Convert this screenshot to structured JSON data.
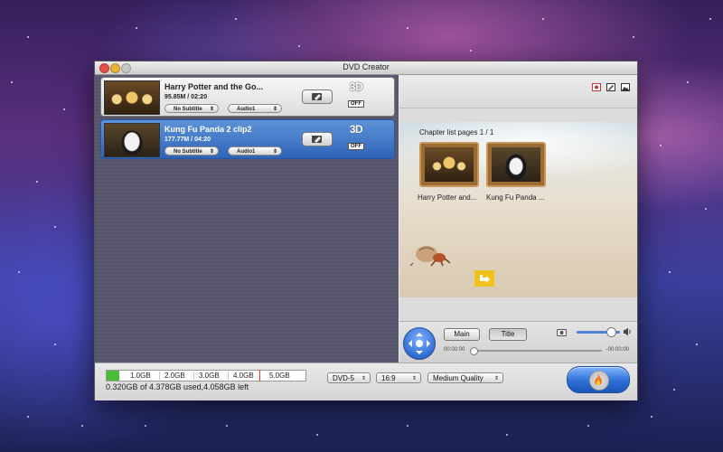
{
  "window": {
    "title": "DVD Creator"
  },
  "items": [
    {
      "name": "Harry Potter and the Go...",
      "meta": "95.85M / 02:20",
      "subtitle": "No Subtitle",
      "audio": "Audio1",
      "threed": "3D",
      "threed_state": "OFF",
      "selected": false
    },
    {
      "name": "Kung Fu Panda 2 clip2",
      "meta": "177.77M / 04:20",
      "subtitle": "No Subtitle",
      "audio": "Audio1",
      "threed": "3D",
      "threed_state": "OFF",
      "selected": true
    }
  ],
  "preview": {
    "chapter_header": "Chapter list pages 1 / 1",
    "chapters": [
      "Harry Potter and...",
      "Kung Fu Panda ..."
    ]
  },
  "controls": {
    "main_label": "Main",
    "title_label": "Title",
    "time_start": "00:00:00",
    "time_end": "-00:00:00",
    "volume_level": 0.78
  },
  "bottom": {
    "capacity_ticks": [
      "1.0GB",
      "2.0GB",
      "3.0GB",
      "4.0GB",
      "5.0GB"
    ],
    "usage_text": "0.320GB of 4.378GB used,4.058GB left",
    "used_fraction": 0.064,
    "disc_type": "DVD-5",
    "aspect": "16:9",
    "quality": "Medium Quality"
  },
  "colors": {
    "selection": "#2e64b7",
    "capacity_used": "#4cbb3a",
    "capacity_limit": "#ee3333",
    "next_arrow": "#f0c21a"
  },
  "icons": [
    "edit-icon",
    "chevron-updown-icon",
    "camera-icon",
    "volume-icon",
    "burn-disc-icon",
    "next-page-icon",
    "snapshot-icon",
    "photo-icon",
    "edit-template-icon"
  ]
}
